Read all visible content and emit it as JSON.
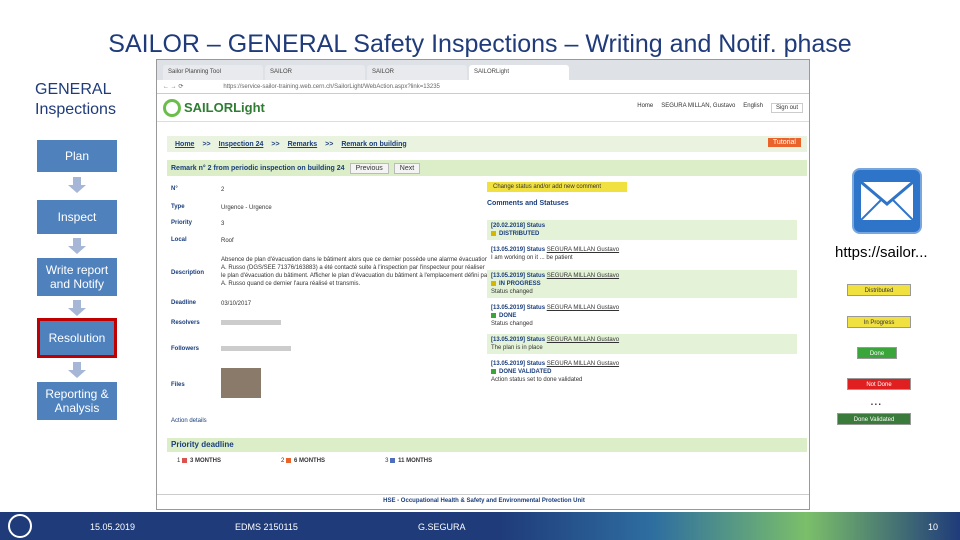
{
  "slide": {
    "title": "SAILOR – GENERAL Safety Inspections – Writing and Notif. phase",
    "section": "GENERAL Inspections"
  },
  "steps": [
    "Plan",
    "Inspect",
    "Write report and Notify",
    "Resolution",
    "Reporting & Analysis"
  ],
  "browser": {
    "tabs": [
      "Sailor Planning Tool",
      "SAILOR",
      "SAILOR",
      "SAILORLight"
    ],
    "url": "https://service-sailor-training.web.cern.ch/SailorLight/WebAction.aspx?link=13235"
  },
  "app": {
    "logo": "SAILORLight",
    "home": "Home",
    "lang": "English",
    "user": "SEGURA MILLAN, Gustavo",
    "signout": "Sign out",
    "tutorial": "Tutorial"
  },
  "breadcrumb": [
    "Home",
    ">>",
    "Inspection 24",
    ">>",
    "Remarks",
    ">>",
    "Remark on building"
  ],
  "remark": {
    "title": "Remark n° 2 from periodic inspection on building 24",
    "prev": "Previous",
    "next": "Next",
    "fields": [
      [
        "N°",
        "2"
      ],
      [
        "Type",
        "Urgence - Urgence"
      ],
      [
        "Priority",
        "3"
      ],
      [
        "Local",
        "Roof"
      ],
      [
        "Description",
        "Absence de plan d'évacuation dans le bâtiment alors que ce dernier possède une alarme évacuation. A. Russo (DGS/SEE 71376/163883) a été contacté suite à l'inspection par l'inspecteur pour réaliser le plan d'évacuation du bâtiment. Afficher le plan d'évacuation du bâtiment à l'emplacement défini par A. Russo quand ce dernier l'aura réalisé et transmis."
      ],
      [
        "Deadline",
        "03/10/2017"
      ],
      [
        "Resolvers",
        ""
      ],
      [
        "Followers",
        ""
      ],
      [
        "Files",
        ""
      ]
    ],
    "action": "Action details"
  },
  "comments": {
    "change": "Change status and/or add new comment",
    "heading": "Comments and Statuses",
    "entries": [
      {
        "date": "[20.02.2018] Status",
        "user": "",
        "status": "DISTRIBUTED",
        "note": "",
        "color": "#d4b800"
      },
      {
        "date": "[13.05.2019] Status",
        "user": "SEGURA MILLAN Gustavo",
        "status": "",
        "note": "I am working on it ... be patient",
        "color": ""
      },
      {
        "date": "[13.05.2019] Status",
        "user": "SEGURA MILLAN Gustavo",
        "status": "IN PROGRESS",
        "note": "Status changed",
        "color": "#d4b800"
      },
      {
        "date": "[13.05.2019] Status",
        "user": "SEGURA MILLAN Gustavo",
        "status": "DONE",
        "note": "Status changed",
        "color": "#3aa53a"
      },
      {
        "date": "[13.05.2019] Status",
        "user": "SEGURA MILLAN Gustavo",
        "status": "",
        "note": "The plan is in place",
        "color": ""
      },
      {
        "date": "[13.05.2019] Status",
        "user": "SEGURA MILLAN Gustavo",
        "status": "DONE VALIDATED",
        "note": "Action status set to done validated",
        "color": "#3aa53a"
      }
    ]
  },
  "priority": {
    "title": "Priority deadline",
    "items": [
      [
        "1",
        "3 MONTHS",
        "#d9534f"
      ],
      [
        "2",
        "6 MONTHS",
        "#e9632a"
      ],
      [
        "3",
        "11 MONTHS",
        "#4f6fbd"
      ]
    ]
  },
  "footer": "HSE - Occupational Health & Safety and Environmental Protection Unit",
  "notif": {
    "url": "https://sailor..."
  },
  "statuses": [
    [
      "Distributed",
      "#f0e040",
      "#333"
    ],
    [
      "In Progress",
      "#f0e040",
      "#333"
    ],
    [
      "Done",
      "#3aa53a",
      "#fff"
    ],
    [
      "Not Done",
      "#e02020",
      "#fff"
    ],
    [
      "Done Validated",
      "#3a7a3a",
      "#fff"
    ]
  ],
  "more": "...",
  "bottom": {
    "date": "15.05.2019",
    "edms": "EDMS 2150115",
    "author": "G.SEGURA",
    "page": "10"
  }
}
